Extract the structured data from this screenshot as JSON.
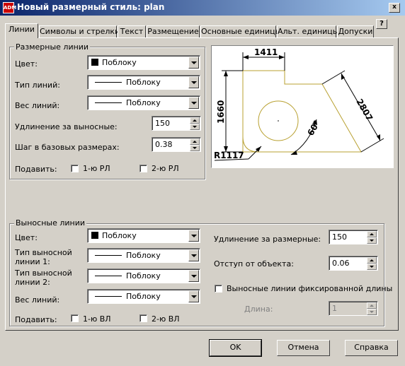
{
  "window": {
    "title": "Новый размерный стиль: plan",
    "app_icon_text": "ADM",
    "close_label": "x",
    "help_label": "?"
  },
  "tabs": [
    {
      "label": "Линии"
    },
    {
      "label": "Символы и стрелки"
    },
    {
      "label": "Текст"
    },
    {
      "label": "Размещение"
    },
    {
      "label": "Основные единицы"
    },
    {
      "label": "Альт. единицы"
    },
    {
      "label": "Допуски"
    }
  ],
  "dim_lines": {
    "legend": "Размерные линии",
    "color_label": "Цвет:",
    "color_value": "Поблоку",
    "linetype_label": "Тип линий:",
    "linetype_value": "Поблоку",
    "lineweight_label": "Вес линий:",
    "lineweight_value": "Поблоку",
    "extend_label": "Удлинение за выносные:",
    "extend_value": "150",
    "baseline_label": "Шаг в базовых размерах:",
    "baseline_value": "0.38",
    "suppress_label": "Подавить:",
    "suppress_1": "1-ю РЛ",
    "suppress_2": "2-ю РЛ"
  },
  "preview": {
    "dim_top": "1411",
    "dim_left": "1660",
    "dim_diag": "2807",
    "dim_angle": "60°",
    "dim_radius": "R1117"
  },
  "ext_lines": {
    "legend": "Выносные линии",
    "color_label": "Цвет:",
    "color_value": "Поблоку",
    "linetype1_label_a": "Тип выносной",
    "linetype1_label_b": "линии 1:",
    "linetype1_value": "Поблоку",
    "linetype2_label_a": "Тип выносной",
    "linetype2_label_b": "линии 2:",
    "linetype2_value": "Поблоку",
    "lineweight_label": "Вес линий:",
    "lineweight_value": "Поблоку",
    "suppress_label": "Подавить:",
    "suppress_1": "1-ю ВЛ",
    "suppress_2": "2-ю ВЛ",
    "extend_label": "Удлинение за размерные:",
    "extend_value": "150",
    "offset_label": "Отступ от объекта:",
    "offset_value": "0.06",
    "fixed_label": "Выносные линии фиксированной длины",
    "length_label": "Длина:",
    "length_value": "1"
  },
  "buttons": {
    "ok": "OK",
    "cancel": "Отмена",
    "help": "Справка"
  },
  "colors": {
    "title_start": "#0a246a",
    "title_end": "#a6caf0",
    "face": "#d4d0c8",
    "preview_geometry": "#b8a030"
  }
}
